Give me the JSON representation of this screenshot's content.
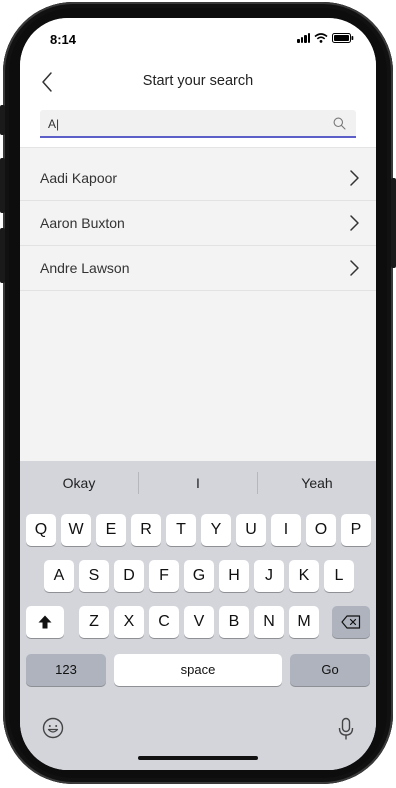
{
  "status_bar": {
    "time": "8:14"
  },
  "nav": {
    "title": "Start your search"
  },
  "search": {
    "value": "A|"
  },
  "results": [
    {
      "name": "Aadi Kapoor"
    },
    {
      "name": "Aaron Buxton"
    },
    {
      "name": "Andre Lawson"
    }
  ],
  "keyboard": {
    "suggestions": [
      "Okay",
      "I",
      "Yeah"
    ],
    "row1": [
      "Q",
      "W",
      "E",
      "R",
      "T",
      "Y",
      "U",
      "I",
      "O",
      "P"
    ],
    "row2": [
      "A",
      "S",
      "D",
      "F",
      "G",
      "H",
      "J",
      "K",
      "L"
    ],
    "row3": [
      "Z",
      "X",
      "C",
      "V",
      "B",
      "N",
      "M"
    ],
    "numbers_label": "123",
    "space_label": "space",
    "go_label": "Go"
  },
  "colors": {
    "accent": "#5b5fc7",
    "keyboard_bg": "#d3d5db",
    "list_bg": "#f3f3f3"
  }
}
